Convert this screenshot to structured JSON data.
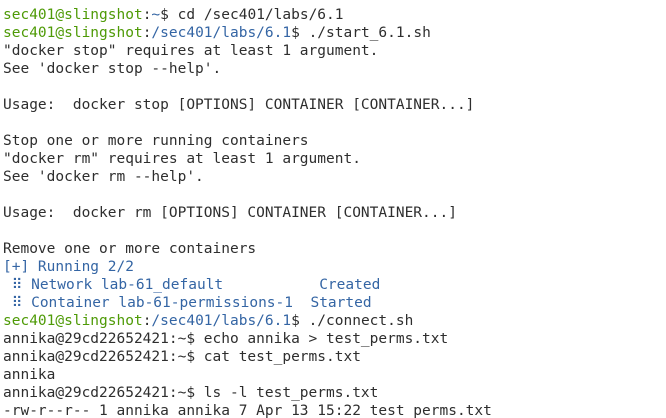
{
  "colors": {
    "prompt_user": "#4e9a06",
    "prompt_path": "#3465a4",
    "text": "#2e2e2e",
    "background": "#ffffff",
    "compose_blue": "#3465a4"
  },
  "lines": [
    {
      "type": "prompt",
      "user": "sec401@slingshot",
      "sep": ":",
      "path": "~",
      "suffix": "$ ",
      "cmd": "cd /sec401/labs/6.1"
    },
    {
      "type": "prompt",
      "user": "sec401@slingshot",
      "sep": ":",
      "path": "/sec401/labs/6.1",
      "suffix": "$ ",
      "cmd": "./start_6.1.sh"
    },
    {
      "type": "text",
      "text": "\"docker stop\" requires at least 1 argument."
    },
    {
      "type": "text",
      "text": "See 'docker stop --help'."
    },
    {
      "type": "text",
      "text": ""
    },
    {
      "type": "text",
      "text": "Usage:  docker stop [OPTIONS] CONTAINER [CONTAINER...]"
    },
    {
      "type": "text",
      "text": ""
    },
    {
      "type": "text",
      "text": "Stop one or more running containers"
    },
    {
      "type": "text",
      "text": "\"docker rm\" requires at least 1 argument."
    },
    {
      "type": "text",
      "text": "See 'docker rm --help'."
    },
    {
      "type": "text",
      "text": ""
    },
    {
      "type": "text",
      "text": "Usage:  docker rm [OPTIONS] CONTAINER [CONTAINER...]"
    },
    {
      "type": "text",
      "text": ""
    },
    {
      "type": "text",
      "text": "Remove one or more containers"
    },
    {
      "type": "blue",
      "text": "[+] Running 2/2"
    },
    {
      "type": "compose",
      "prefix": " ⠿ ",
      "name": "Network lab-61_default",
      "pad": "           ",
      "status": "Created"
    },
    {
      "type": "compose",
      "prefix": " ⠿ ",
      "name": "Container lab-61-permissions-1",
      "pad": "  ",
      "status": "Started"
    },
    {
      "type": "prompt",
      "user": "sec401@slingshot",
      "sep": ":",
      "path": "/sec401/labs/6.1",
      "suffix": "$ ",
      "cmd": "./connect.sh"
    },
    {
      "type": "text",
      "text": "annika@29cd22652421:~$ echo annika > test_perms.txt"
    },
    {
      "type": "text",
      "text": "annika@29cd22652421:~$ cat test_perms.txt"
    },
    {
      "type": "text",
      "text": "annika"
    },
    {
      "type": "text",
      "text": "annika@29cd22652421:~$ ls -l test_perms.txt"
    },
    {
      "type": "text",
      "text": "-rw-r--r-- 1 annika annika 7 Apr 13 15:22 test_perms.txt"
    }
  ]
}
